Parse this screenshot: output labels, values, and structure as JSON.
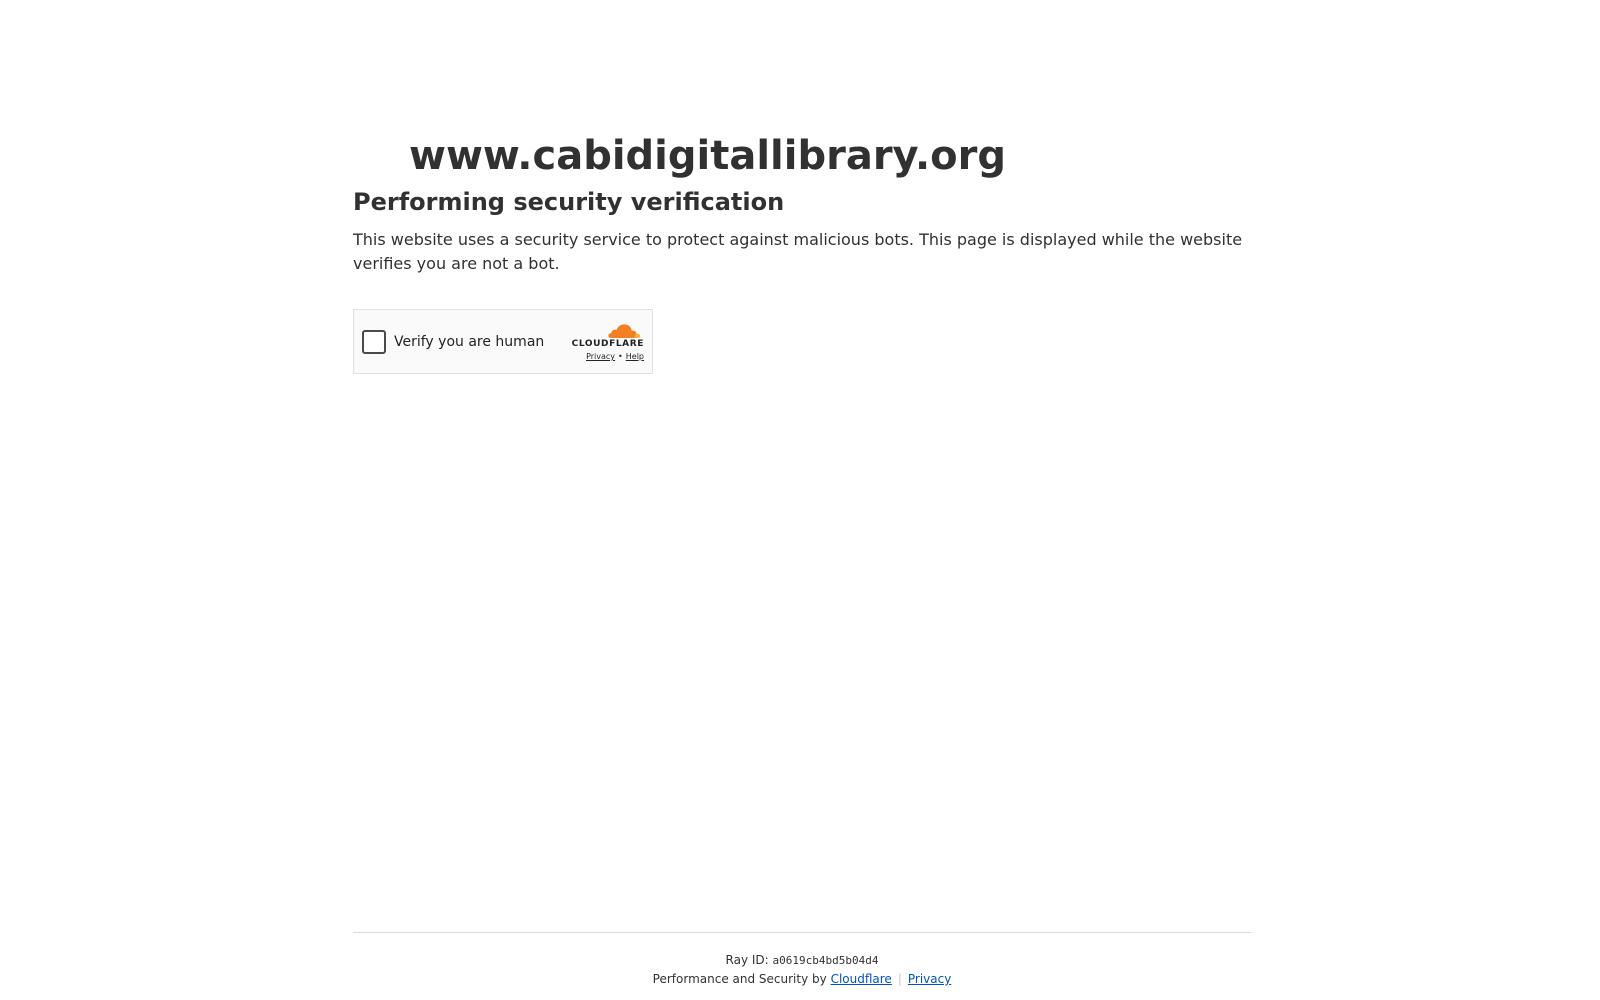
{
  "header": {
    "site_title": "www.cabidigitallibrary.org",
    "heading": "Performing security verification",
    "description": "This website uses a security service to protect against malicious bots. This page is displayed while the website verifies you are not a bot."
  },
  "widget": {
    "checkbox_label": "Verify you are human",
    "brand_name": "CLOUDFLARE",
    "privacy_link": "Privacy",
    "separator": "•",
    "help_link": "Help",
    "brand_color": "#f38020"
  },
  "footer": {
    "ray_label": "Ray ID:",
    "ray_id": "a0619cb4bd5b04d4",
    "perf_text": "Performance and Security by",
    "cloudflare_link": "Cloudflare",
    "separator": "|",
    "privacy_link": "Privacy",
    "link_color": "#0051c3"
  }
}
